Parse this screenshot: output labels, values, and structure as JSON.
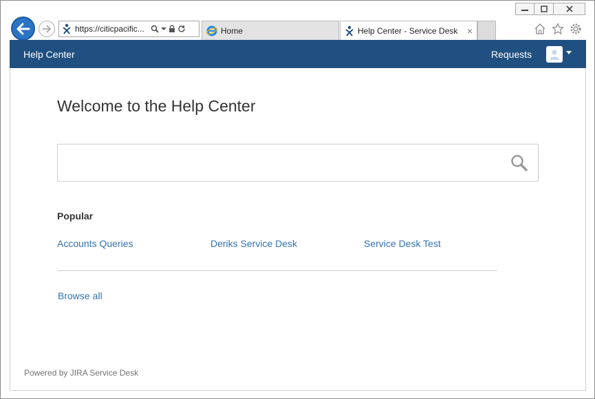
{
  "browser": {
    "address": "https://citicpacific...",
    "tabs": [
      {
        "label": "Home"
      },
      {
        "label": "Help Center - Service Desk",
        "close": "×"
      }
    ]
  },
  "header": {
    "title": "Help Center",
    "requests": "Requests"
  },
  "main": {
    "welcome": "Welcome to the Help Center",
    "popular_heading": "Popular",
    "popular_links": [
      "Accounts Queries",
      "Deriks Service Desk",
      "Service Desk Test"
    ],
    "browse_all": "Browse all"
  },
  "footer": {
    "text": "Powered by JIRA Service Desk"
  },
  "colors": {
    "header_bg": "#205081",
    "link": "#3572b0",
    "ie_back": "#2b74c3"
  }
}
